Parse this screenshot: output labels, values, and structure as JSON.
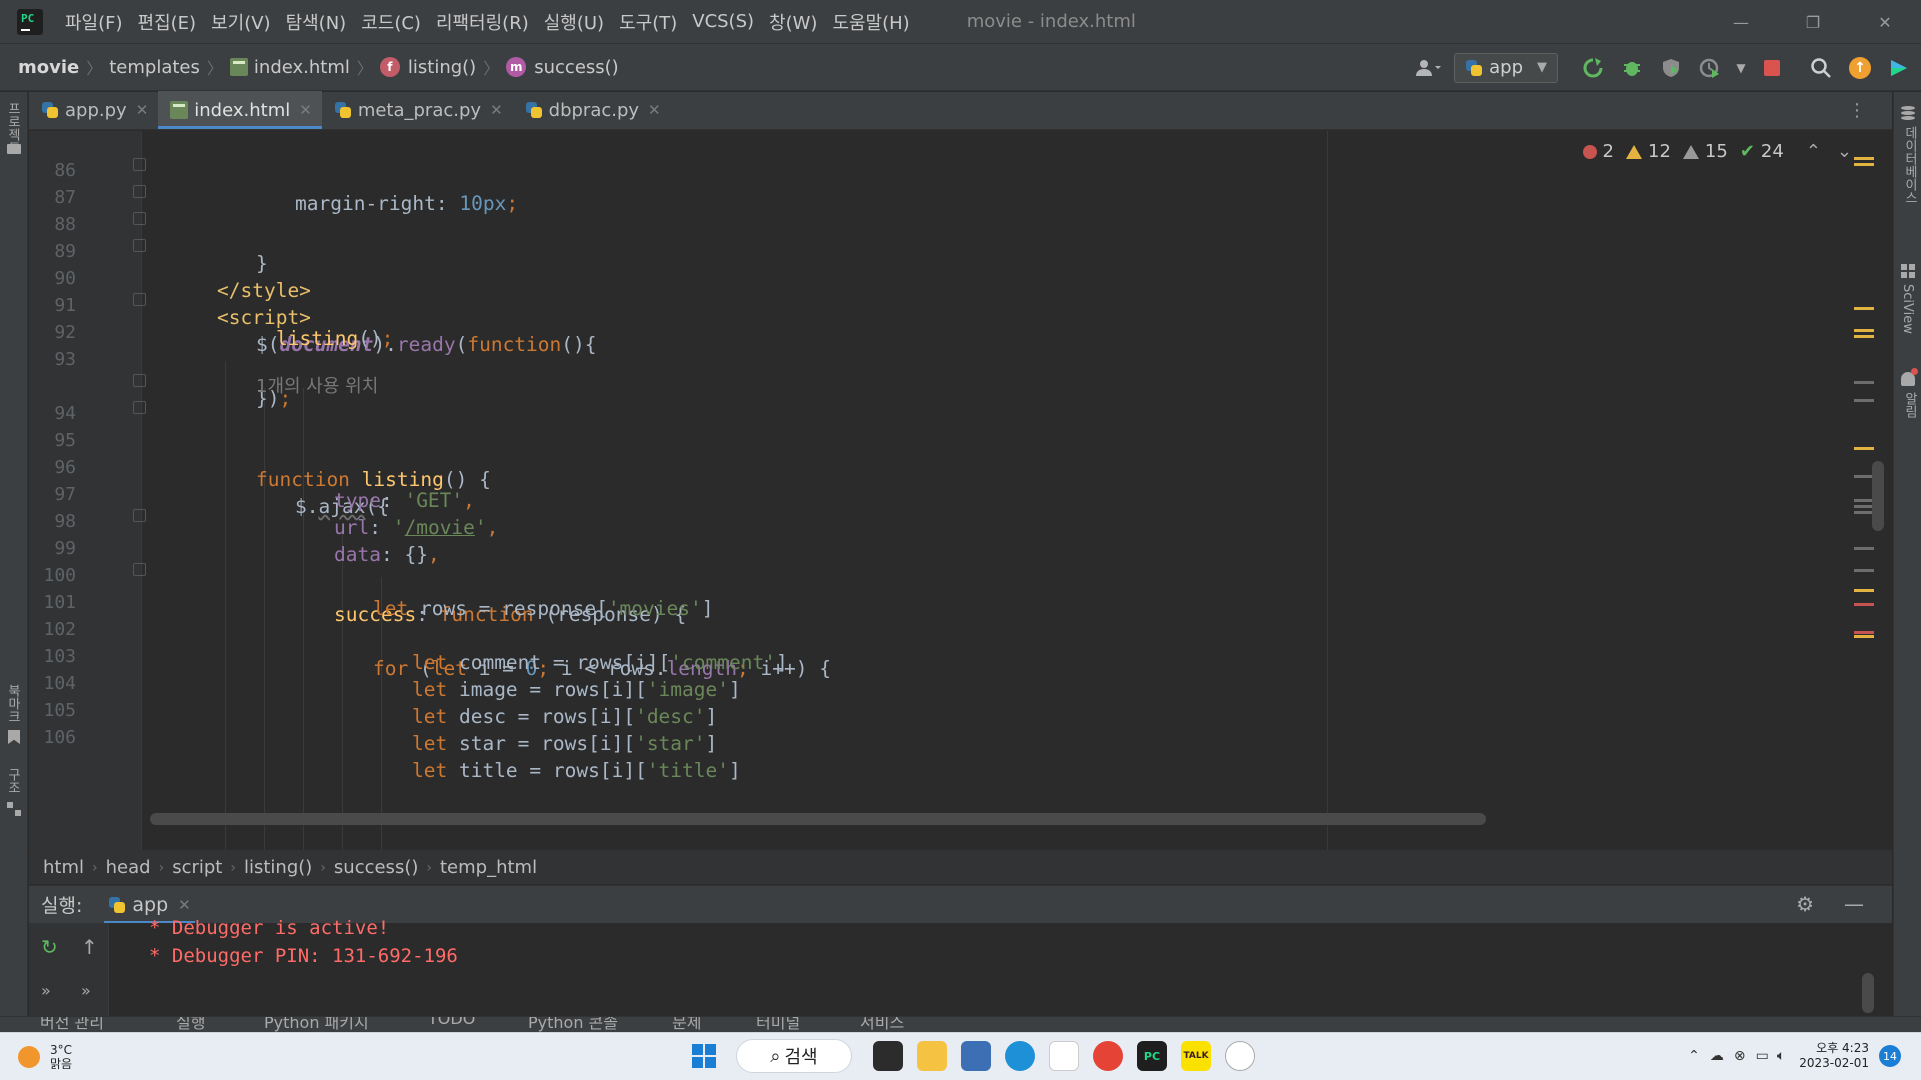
{
  "window": {
    "title": "movie - index.html",
    "menu": [
      "파일(F)",
      "편집(E)",
      "보기(V)",
      "탐색(N)",
      "코드(C)",
      "리팩터링(R)",
      "실행(U)",
      "도구(T)",
      "VCS(S)",
      "창(W)",
      "도움말(H)"
    ],
    "controls": {
      "minimize": "—",
      "restore": "❐",
      "close": "✕"
    }
  },
  "navbar": {
    "project": "movie",
    "folder": "templates",
    "file": "index.html",
    "func1": "listing()",
    "func2": "success()",
    "run_config": "app"
  },
  "tabs": [
    {
      "label": "app.py",
      "type": "python"
    },
    {
      "label": "index.html",
      "type": "html",
      "active": true
    },
    {
      "label": "meta_prac.py",
      "type": "python"
    },
    {
      "label": "dbprac.py",
      "type": "python"
    }
  ],
  "left_stripe": {
    "project": "프로젝트",
    "bookmarks": "북마크",
    "structure": "구조"
  },
  "right_stripe": {
    "database": "데이터베이스",
    "sciview": "SciView",
    "notifications": "알림"
  },
  "inspections": {
    "errors": "2",
    "warnings": "12",
    "weak_warnings": "15",
    "typos": "24"
  },
  "code": {
    "line_numbers": [
      "86",
      "87",
      "88",
      "89",
      "90",
      "91",
      "92",
      "93",
      "",
      "94",
      "95",
      "96",
      "97",
      "98",
      "99",
      "100",
      "101",
      "102",
      "103",
      "104",
      "105",
      "106"
    ],
    "usage_hint": "1개의 사용 위치"
  },
  "structure_path": [
    "html",
    "head",
    "script",
    "listing()",
    "success()",
    "temp_html"
  ],
  "run": {
    "label": "실행:",
    "tab": "app",
    "console": [
      "* Debugger is active!",
      "* Debugger PIN: 131-692-196"
    ]
  },
  "bottom_tools": [
    "버전 관리",
    "실행",
    "Python 패키지",
    "TODO",
    "Python 콘솔",
    "문제",
    "터미널",
    "서비스"
  ],
  "taskbar": {
    "weather_temp": "3°C",
    "weather_desc": "맑음",
    "search": "검색",
    "time": "오후 4:23",
    "date": "2023-02-01",
    "notifications": "14"
  },
  "colors": {
    "accent": "#4a88c7",
    "keyword": "#cc7832",
    "string": "#6a8759",
    "number": "#6897bb",
    "tag": "#e8bf6a",
    "function": "#ffc66d",
    "property": "#9876aa",
    "console_error": "#ff6b68"
  }
}
